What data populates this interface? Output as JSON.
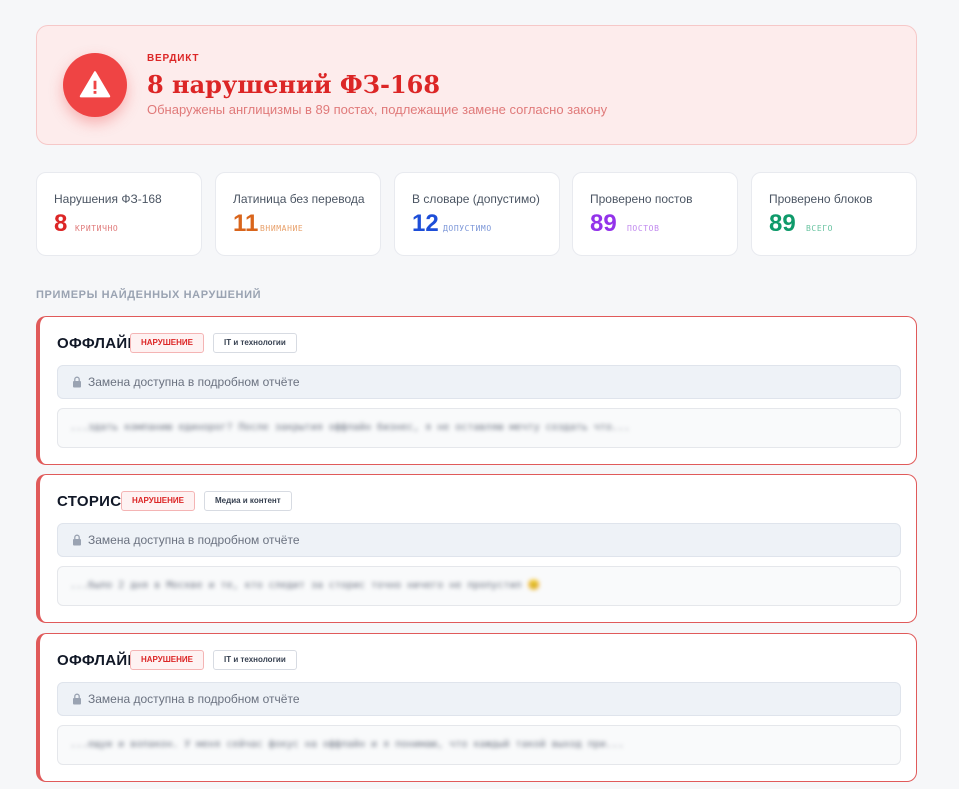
{
  "verdict": {
    "kicker": "ВЕРДИКТ",
    "title": "8 нарушений ФЗ-168",
    "subtitle": "Обнаружены англицизмы в 89 постах, подлежащие замене согласно закону",
    "icon": "warning-triangle-icon",
    "color": "#ef4444"
  },
  "stats": [
    {
      "label": "Нарушения ФЗ-168",
      "value": "8",
      "tag": "КРИТИЧНО",
      "color": "#dc2626",
      "tag_color": "#e07a7a"
    },
    {
      "label": "Латиница без перевода",
      "value": "11",
      "tag": "ВНИМАНИЕ",
      "color": "#d9651c",
      "tag_color": "#e8a06a"
    },
    {
      "label": "В словаре (допустимо)",
      "value": "12",
      "tag": "ДОПУСТИМО",
      "color": "#1d4ed8",
      "tag_color": "#7b96d8"
    },
    {
      "label": "Проверено постов",
      "value": "89",
      "tag": "ПОСТОВ",
      "color": "#9333ea",
      "tag_color": "#c089ee"
    },
    {
      "label": "Проверено блоков",
      "value": "89",
      "tag": "ВСЕГО",
      "color": "#0f9a6a",
      "tag_color": "#6ac4a2"
    }
  ],
  "section_title": "ПРИМЕРЫ НАЙДЕННЫХ НАРУШЕНИЙ",
  "violations": [
    {
      "word": "ОФФЛАЙН",
      "badge": "НАРУШЕНИЕ",
      "category": "IT и технологии",
      "replacement": "Замена доступна в подробном отчёте",
      "snippet": "...здать компанию единорог? После закрытия оффлайн бизнес, я не оставляю мечту создать что..."
    },
    {
      "word": "СТОРИС",
      "badge": "НАРУШЕНИЕ",
      "category": "Медиа и контент",
      "replacement": "Замена доступна в подробном отчёте",
      "snippet": "...было 2 дня в Москве и те, кто следит за сторис точно ничего не пропустил 😊"
    },
    {
      "word": "ОФФЛАЙН",
      "badge": "НАРУШЕНИЕ",
      "category": "IT и технологии",
      "replacement": "Замена доступна в подробном отчёте",
      "snippet": "...ещуи и вопакон. У меня сейчас фокус на оффлайн и я понимаю, что каждый такой выход при..."
    }
  ],
  "colors": {
    "accent": "#dc2626",
    "banner_bg": "#fdecec",
    "page_bg": "#f6f7f9"
  }
}
